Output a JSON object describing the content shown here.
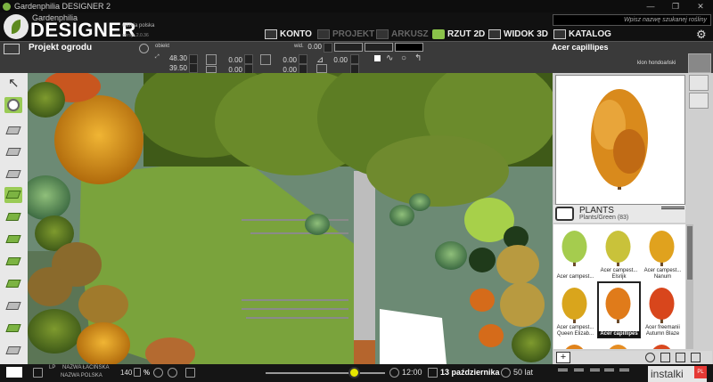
{
  "window": {
    "title": "Gardenphilia DESIGNER 2",
    "controls": [
      "—",
      "❐",
      "✕"
    ]
  },
  "brand": {
    "small": "Gardenphilia",
    "big": "DESIGNER",
    "version": "wersja polska",
    "build": "wersja 2.0.36"
  },
  "nav": {
    "konto": "KONTO",
    "projekt": "PROJEKT",
    "arkusz": "ARKUSZ",
    "rzut2d": "RZUT 2D",
    "widok3d": "WIDOK 3D",
    "katalog": "KATALOG"
  },
  "search": {
    "placeholder": "Wpisz nazwę szukanej rośliny"
  },
  "toolbar": {
    "project_name": "Projekt ogrodu",
    "obiekt_label": "obiekt",
    "wid_label": "wid.",
    "wid_value": "0.00",
    "pos_x": "48.30",
    "pos_y": "39.50",
    "size_a": "0.00",
    "size_b": "0.00",
    "rot_a": "0.00",
    "rot_b": "0.00",
    "angle": "0.00"
  },
  "selected_plant": {
    "latin": "Acer capillipes",
    "polish": "klon hondoański"
  },
  "catalog": {
    "title": "PLANTS",
    "subtitle": "Plants/Green",
    "count": "(83)",
    "items": [
      {
        "label": "Acer campest..."
      },
      {
        "label": "Acer campest... Elsrijk"
      },
      {
        "label": "Acer campest... Nanum"
      },
      {
        "label": "Acer campest... Queen Elizab..."
      },
      {
        "label": "Acer capillipes"
      },
      {
        "label": "Acer freemanii Autumn Blaze"
      },
      {
        "label": ""
      },
      {
        "label": ""
      },
      {
        "label": ""
      }
    ],
    "item_colors": [
      "#a5cc4e",
      "#c9c23a",
      "#e0a21e",
      "#d9a51c",
      "#e07b1a",
      "#d8461c",
      "#e0831b",
      "#e58d23",
      "#d9481f"
    ]
  },
  "statusbar": {
    "lp": "LP",
    "latin": "NAZWA ŁACIŃSKA",
    "polish": "NAZWA POLSKA",
    "zoom": "140",
    "zoom_unit": "%",
    "time_slider": 0.74,
    "time": "12:00",
    "date": "13 października",
    "years": "50 lat",
    "watermark": "instalki",
    "watermark_badge": "PL"
  }
}
